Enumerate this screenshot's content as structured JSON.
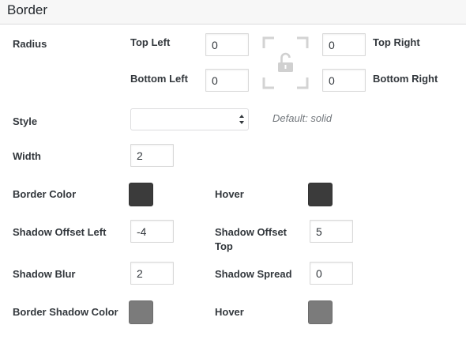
{
  "section": {
    "title": "Border"
  },
  "radius": {
    "label": "Radius",
    "top_left": {
      "label": "Top Left",
      "value": "0"
    },
    "top_right": {
      "label": "Top Right",
      "value": "0"
    },
    "bottom_left": {
      "label": "Bottom Left",
      "value": "0"
    },
    "bottom_right": {
      "label": "Bottom Right",
      "value": "0"
    },
    "lock_icon": "unlock-icon"
  },
  "style": {
    "label": "Style",
    "value": "",
    "hint": "Default: solid"
  },
  "width": {
    "label": "Width",
    "value": "2"
  },
  "border_color": {
    "label": "Border Color",
    "color": "#3b3b3b",
    "hover_label": "Hover",
    "hover_color": "#3b3b3b"
  },
  "shadow_offset": {
    "left_label": "Shadow Offset Left",
    "left_value": "-4",
    "top_label_line1": "Shadow Offset",
    "top_label_line2": "Top",
    "top_value": "5"
  },
  "shadow_blur": {
    "label": "Shadow Blur",
    "value": "2"
  },
  "shadow_spread": {
    "label": "Shadow Spread",
    "value": "0"
  },
  "border_shadow_color": {
    "label": "Border Shadow Color",
    "color": "#7b7b7b",
    "hover_label": "Hover",
    "hover_color": "#7b7b7b"
  }
}
